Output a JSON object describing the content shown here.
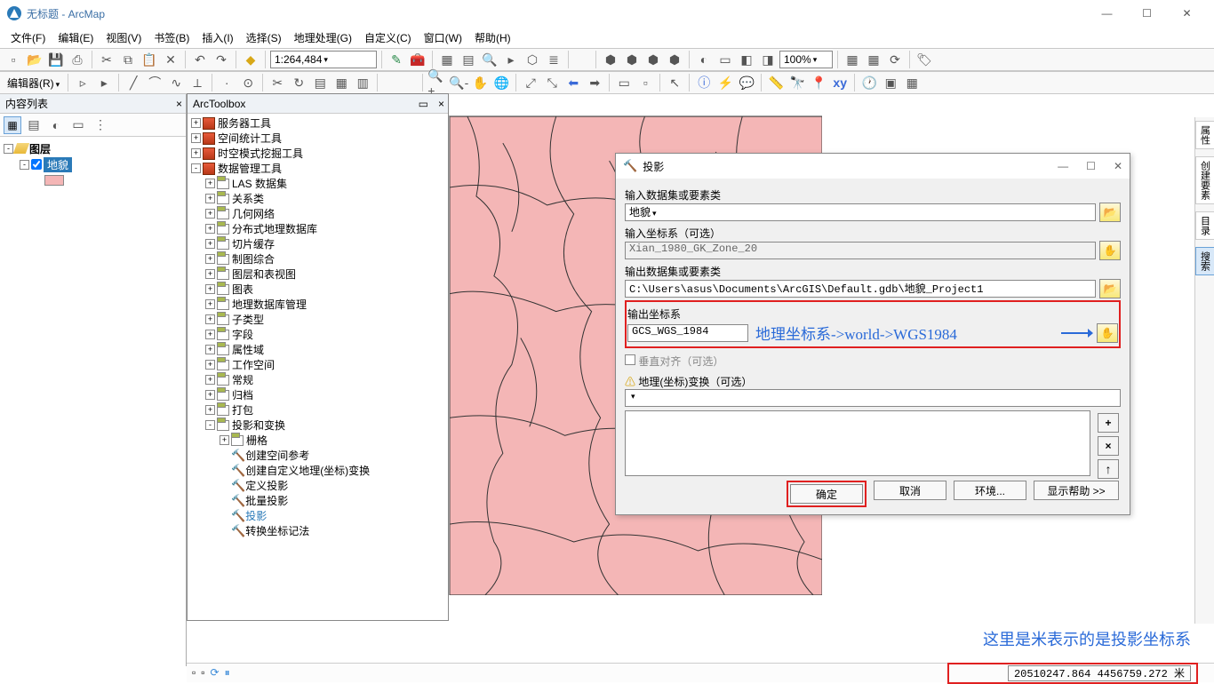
{
  "window": {
    "title": "无标题 - ArcMap"
  },
  "menu": [
    "文件(F)",
    "编辑(E)",
    "视图(V)",
    "书签(B)",
    "插入(I)",
    "选择(S)",
    "地理处理(G)",
    "自定义(C)",
    "窗口(W)",
    "帮助(H)"
  ],
  "scale": "1:264,484",
  "zoom_pct": "100%",
  "editor_label": "编辑器(R)",
  "toc": {
    "title": "内容列表",
    "root": "图层",
    "layer": "地貌"
  },
  "arctoolbox": {
    "title": "ArcToolbox",
    "top_groups": [
      "服务器工具",
      "空间统计工具",
      "时空模式挖掘工具"
    ],
    "dm_group": "数据管理工具",
    "dm_items": [
      "LAS 数据集",
      "关系类",
      "几何网络",
      "分布式地理数据库",
      "切片缓存",
      "制图综合",
      "图层和表视图",
      "图表",
      "地理数据库管理",
      "子类型",
      "字段",
      "属性域",
      "工作空间",
      "常规",
      "归档",
      "打包"
    ],
    "proj_group": "投影和变换",
    "raster_sub": "栅格",
    "proj_tools": [
      "创建空间参考",
      "创建自定义地理(坐标)变换",
      "定义投影",
      "批量投影",
      "投影",
      "转换坐标记法"
    ]
  },
  "dialog": {
    "title": "投影",
    "lbl_input_ds": "输入数据集或要素类",
    "val_input_ds": "地貌",
    "lbl_in_cs": "输入坐标系（可选）",
    "val_in_cs": "Xian_1980_GK_Zone_20",
    "lbl_out_ds": "输出数据集或要素类",
    "val_out_ds": "C:\\Users\\asus\\Documents\\ArcGIS\\Default.gdb\\地貌_Project1",
    "lbl_out_cs": "输出坐标系",
    "val_out_cs": "GCS_WGS_1984",
    "annot_cs": "地理坐标系->world->WGS1984",
    "lbl_vert": "垂直对齐（可选）",
    "lbl_geotrans": "地理(坐标)变换（可选）",
    "btn_ok": "确定",
    "btn_cancel": "取消",
    "btn_env": "环境...",
    "btn_help": "显示帮助 >>"
  },
  "annotation2": "这里是米表示的是投影坐标系",
  "status_coord": "20510247.864  4456759.272 米",
  "right_tabs": [
    "属性",
    "创建要素",
    "目录",
    "搜索"
  ]
}
